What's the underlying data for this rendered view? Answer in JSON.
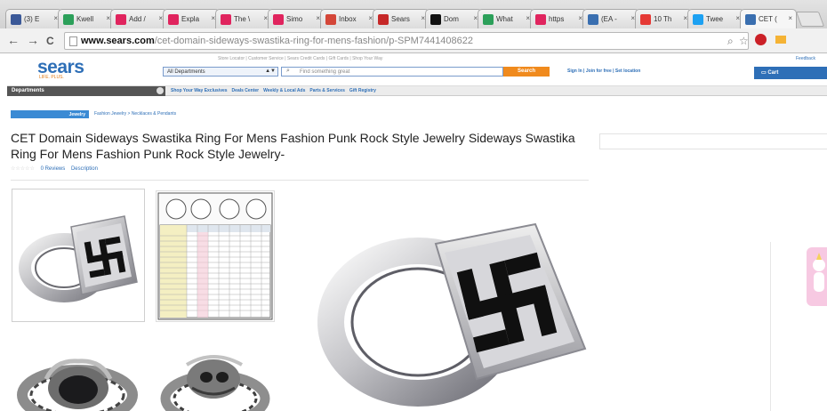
{
  "browser": {
    "tabs": [
      {
        "label": "(3) E",
        "color": "#3b5998"
      },
      {
        "label": "Kwell",
        "color": "#2ca05a"
      },
      {
        "label": "Add /",
        "color": "#e0245e"
      },
      {
        "label": "Expla",
        "color": "#e0245e"
      },
      {
        "label": "The \\",
        "color": "#e0245e"
      },
      {
        "label": "Simo",
        "color": "#e0245e"
      },
      {
        "label": "Inbox",
        "color": "#d44638"
      },
      {
        "label": "Sears",
        "color": "#c62828"
      },
      {
        "label": "Dom",
        "color": "#111111"
      },
      {
        "label": "What",
        "color": "#2ca05a"
      },
      {
        "label": "https",
        "color": "#e0245e"
      },
      {
        "label": "(EA -",
        "color": "#3a6fb0"
      },
      {
        "label": "10 Th",
        "color": "#e53935"
      },
      {
        "label": "Twee",
        "color": "#1da1f2"
      },
      {
        "label": "CET (",
        "color": "#3a6fb0"
      }
    ],
    "url_host": "www.sears.com",
    "url_path": "/cet-domain-sideways-swastika-ring-for-mens-fashion/p-SPM7441408622",
    "back_icon": "←",
    "forward_icon": "→",
    "reload_icon": "C",
    "zoom_icon": "⌕",
    "star_icon": "☆"
  },
  "header": {
    "logo": "sears",
    "logo_tag": "LIFE. PLUS.",
    "util_links": "Store Locator  |  Customer Service  |  Sears Credit Cards  |  Gift Cards  |  Shop Your Way",
    "feedback": "Feedback",
    "department_select": "All Departments",
    "search_placeholder": "Find something great",
    "search_button": "Search",
    "account_links": "Sign In  |  Join for free  |  Set location",
    "cart": "Cart"
  },
  "nav": {
    "departments": "Departments",
    "links": [
      "Shop Your Way Exclusives",
      "Deals Center",
      "Weekly & Local Ads",
      "Parts & Services",
      "Gift Registry"
    ]
  },
  "product": {
    "crumb_current": "Jewelry",
    "crumbs": "Fashion Jewelry  >  Necklaces & Pendants",
    "title": "CET Domain Sideways Swastika Ring For Mens Fashion Punk Rock Style Jewelry Sideways Swastika Ring For Mens Fashion Punk Rock Style Jewelry-",
    "stars": "☆☆☆☆☆",
    "reviews": "0 Reviews",
    "description_link": "Description"
  },
  "colors": {
    "sears_blue": "#2e6fb7",
    "search_orange": "#f08a1d"
  }
}
